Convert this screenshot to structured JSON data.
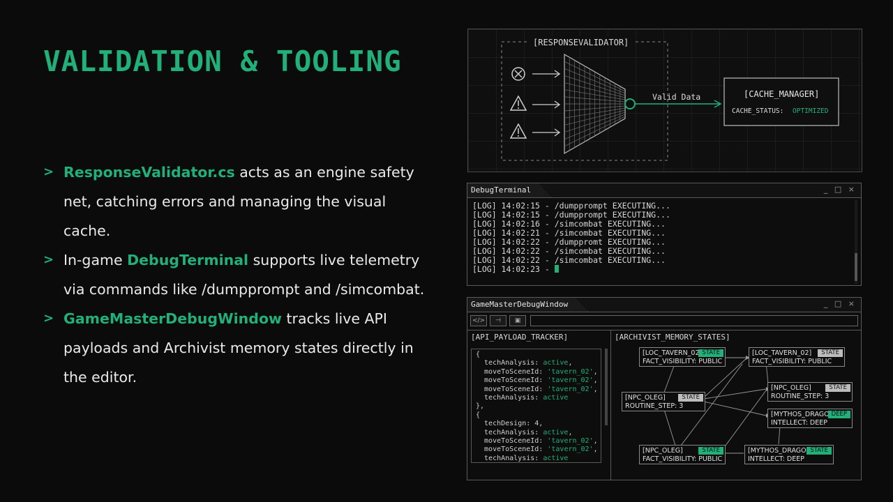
{
  "title": "VALIDATION & TOOLING",
  "bullets": [
    {
      "marker": ">",
      "highlight": "ResponseValidator.cs",
      "text": " acts as an engine safety net, catching errors and managing the visual cache."
    },
    {
      "marker": ">",
      "prefix": "In-game ",
      "highlight": "DebugTerminal",
      "text": " supports live telemetry via commands like /dumpprompt and /simcombat."
    },
    {
      "marker": ">",
      "highlight": "GameMasterDebugWindow",
      "text": " tracks live API payloads and Archivist memory states directly in the editor."
    }
  ],
  "diagram": {
    "validator_label": "[RESPONSEVALIDATOR]",
    "edge_label": "Valid Data",
    "cache_title": "[CACHE_MANAGER]",
    "cache_status_key": "CACHE_STATUS:",
    "cache_status_value": "OPTIMIZED",
    "input_icons": [
      "error-x-icon",
      "warning-icon",
      "warning-icon"
    ],
    "accent": "#22b07a"
  },
  "terminal": {
    "tab": "DebugTerminal",
    "controls": "_ □ ×",
    "lines": [
      "[LOG] 14:02:15 - /dumpprompt EXECUTING...",
      "[LOG] 14:02:15 - /dumpprompt EXECUTING...",
      "[LOG] 14:02:16 - /simcombat EXECUTING...",
      "[LOG] 14:02:21 - /simcombat EXECUTING...",
      "[LOG] 14:02:22 - /dumppromt EXECUTING...",
      "[LOG] 14:02:22 - /simcombat EXECUTING...",
      "[LOG] 14:02:22 - /simcombat EXECUTING..."
    ],
    "prompt_line": "[LOG] 14:02:23 - "
  },
  "gm_window": {
    "tab": "GameMasterDebugWindow",
    "controls": "_ □ ×",
    "toolbar_icons": [
      "code-icon",
      "pin-icon",
      "folder-icon"
    ],
    "api_title": "[API_PAYLOAD_TRACKER]",
    "payload": [
      "{",
      "  techAnalysis: |active|,",
      "  moveToSceneId: |'tavern_02'|,",
      "  moveToSceneId: |'tavern_02'|,",
      "  moveToSceneId: |'tavern_02'|,",
      "  techAnalysis: |active|",
      "},",
      "{",
      "  techDesign: 4,",
      "  techAnalysis: |active|,",
      "  moveToSceneId: |'tavern_02'|,",
      "  moveToSceneId: |'tavern_02'|,",
      "  techAnalysis: |active|",
      "}"
    ],
    "memory_title": "[ARCHIVIST_MEMORY_STATES]",
    "nodes": [
      {
        "l1": "[LOC_TAVERN_02]",
        "l2": "FACT_VISIBILITY: PUBLIC",
        "badge": "STATE",
        "badge_style": "green"
      },
      {
        "l1": "[LOC_TAVERN_02]",
        "l2": "FACT_VISIBILITY: PUBLIC",
        "badge": "STATE",
        "badge_style": "gray"
      },
      {
        "l1": "[NPC_OLEG]",
        "l2": "ROUTINE_STEP: 3",
        "badge": "STATE",
        "badge_style": "gray"
      },
      {
        "l1": "[NPC_OLEG]",
        "l2": "ROUTINE_STEP: 3",
        "badge": "STATE",
        "badge_style": "gray"
      },
      {
        "l1": "[MYTHOS_DRAGON]",
        "l2": "INTELLECT: DEEP",
        "badge": "DEEP",
        "badge_style": "green"
      },
      {
        "l1": "[NPC_OLEG]",
        "l2": "FACT_VISIBILITY: PUBLIC",
        "badge": "STATE",
        "badge_style": "green"
      },
      {
        "l1": "[MYTHOS_DRAGON]",
        "l2": "INTELLECT: DEEP",
        "badge": "STATE",
        "badge_style": "green"
      }
    ]
  }
}
